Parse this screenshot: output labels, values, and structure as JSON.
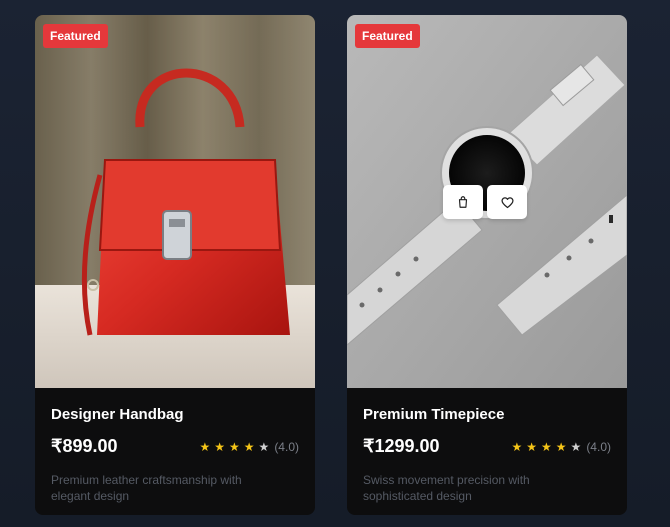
{
  "products": [
    {
      "badge": "Featured",
      "name": "Designer Handbag",
      "price": "₹899.00",
      "rating": "(4.0)",
      "stars": 4,
      "description": "Premium leather craftsmanship with elegant design"
    },
    {
      "badge": "Featured",
      "name": "Premium Timepiece",
      "price": "₹1299.00",
      "rating": "(4.0)",
      "stars": 4,
      "description": "Swiss movement precision with sophisticated design",
      "actions": [
        "cart-icon",
        "heart-icon"
      ]
    }
  ],
  "colors": {
    "badge": "#e5383b",
    "star": "#f5c518",
    "card_bg": "#0d0d0e"
  }
}
